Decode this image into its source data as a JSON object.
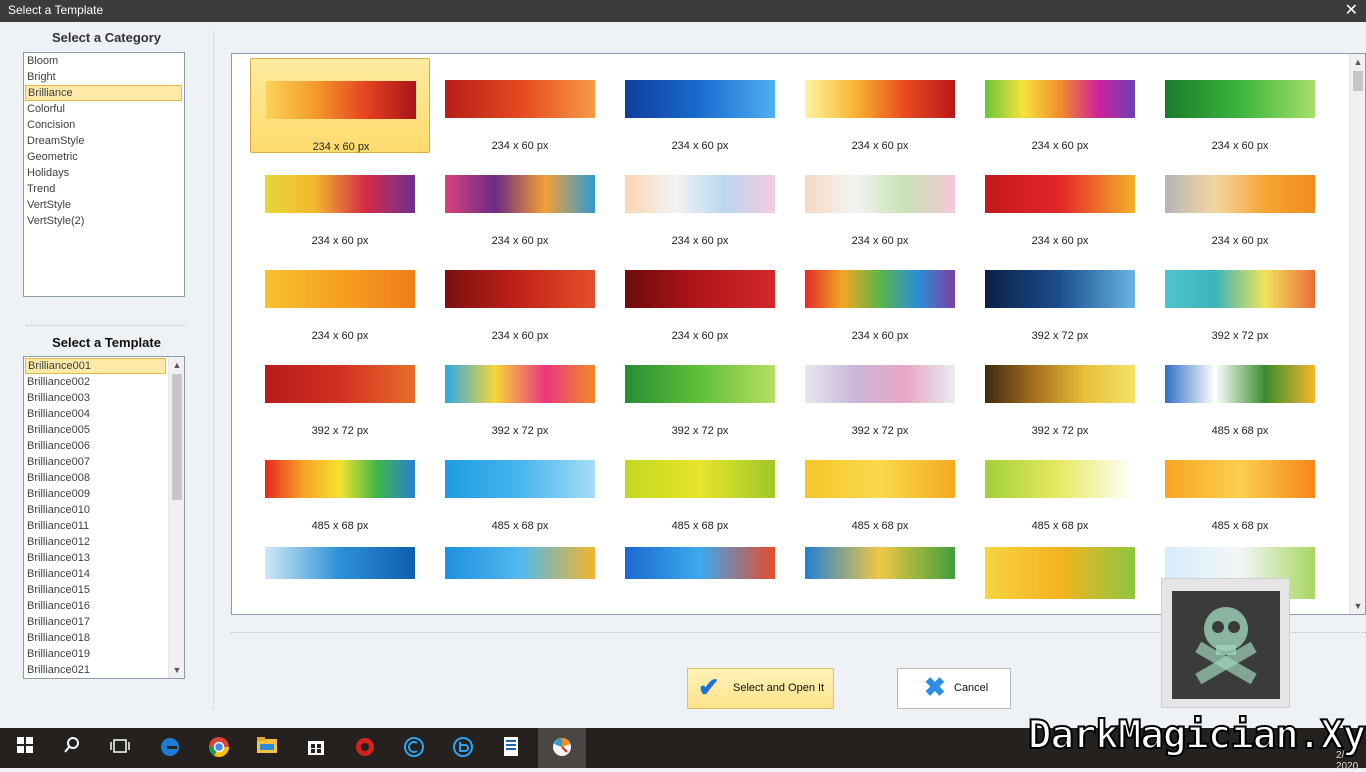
{
  "window": {
    "title": "Select a Template",
    "close_glyph": "✕"
  },
  "category": {
    "heading": "Select a Category",
    "items": [
      "Bloom",
      "Bright",
      "Brilliance",
      "Colorful",
      "Concision",
      "DreamStyle",
      "Geometric",
      "Holidays",
      "Trend",
      "VertStyle",
      "VertStyle(2)"
    ],
    "selected": "Brilliance"
  },
  "template": {
    "heading": "Select a Template",
    "items": [
      "Brilliance001",
      "Brilliance002",
      "Brilliance003",
      "Brilliance004",
      "Brilliance005",
      "Brilliance006",
      "Brilliance007",
      "Brilliance008",
      "Brilliance009",
      "Brilliance010",
      "Brilliance011",
      "Brilliance012",
      "Brilliance013",
      "Brilliance014",
      "Brilliance015",
      "Brilliance016",
      "Brilliance017",
      "Brilliance018",
      "Brilliance019",
      "Brilliance021"
    ],
    "selected": "Brilliance001"
  },
  "gallery": {
    "tiles": [
      {
        "size": "234 x 60 px",
        "selected": true,
        "colors": [
          "#fbd35a",
          "#f39a2a",
          "#e54220",
          "#a8141a"
        ]
      },
      {
        "size": "234 x 60 px",
        "colors": [
          "#b51f18",
          "#e5481e",
          "#f79a47"
        ]
      },
      {
        "size": "234 x 60 px",
        "colors": [
          "#0e3f9a",
          "#1b6bd0",
          "#4fb0ef"
        ]
      },
      {
        "size": "234 x 60 px",
        "colors": [
          "#fff3a0",
          "#f6b531",
          "#e94b1f",
          "#b8171b"
        ]
      },
      {
        "size": "234 x 60 px",
        "colors": [
          "#6ac43c",
          "#f4e33a",
          "#f08f2c",
          "#d2239a",
          "#6b3fb5"
        ]
      },
      {
        "size": "234 x 60 px",
        "colors": [
          "#1b7a2a",
          "#3ab53c",
          "#a6e06a"
        ]
      },
      {
        "size": "234 x 60 px",
        "colors": [
          "#e6d73a",
          "#f3b72e",
          "#d42c47",
          "#6e2f8f"
        ]
      },
      {
        "size": "234 x 60 px",
        "colors": [
          "#d9437b",
          "#6a2b86",
          "#f2a035",
          "#2f9ad6"
        ]
      },
      {
        "size": "234 x 60 px",
        "colors": [
          "#fbd5ae",
          "#f3f3f3",
          "#b9d7f0",
          "#f7c9de"
        ]
      },
      {
        "size": "234 x 60 px",
        "colors": [
          "#f8d9c2",
          "#f3f3f3",
          "#c6e3b5",
          "#f5c7d6"
        ]
      },
      {
        "size": "234 x 60 px",
        "colors": [
          "#c3181c",
          "#e4262a",
          "#f4b12b"
        ]
      },
      {
        "size": "234 x 60 px",
        "colors": [
          "#b5b5b5",
          "#f2d6a1",
          "#f6a534",
          "#ef8c1c"
        ]
      },
      {
        "size": "234 x 60 px",
        "colors": [
          "#f7c230",
          "#f7a01f",
          "#ef7d1a"
        ]
      },
      {
        "size": "234 x 60 px",
        "colors": [
          "#7a0f0f",
          "#c3221a",
          "#e5502a"
        ]
      },
      {
        "size": "234 x 60 px",
        "colors": [
          "#6d0b0b",
          "#b3151b",
          "#d3292a"
        ]
      },
      {
        "size": "234 x 60 px",
        "colors": [
          "#e22c2a",
          "#f2a623",
          "#5bb547",
          "#2b8fd6",
          "#7d3fa4"
        ]
      },
      {
        "size": "392 x 72 px",
        "colors": [
          "#0b1f46",
          "#1c4f8e",
          "#69b4e4"
        ]
      },
      {
        "size": "392 x 72 px",
        "colors": [
          "#52c3ce",
          "#3ab4b9",
          "#f2e35b",
          "#ea6d3a"
        ]
      },
      {
        "size": "392 x 72 px",
        "colors": [
          "#b71b1a",
          "#d22f22",
          "#e86d2a"
        ]
      },
      {
        "size": "392 x 72 px",
        "colors": [
          "#2ea7e3",
          "#f5d53a",
          "#e9377b",
          "#f28a2c"
        ]
      },
      {
        "size": "392 x 72 px",
        "colors": [
          "#2a8d34",
          "#5fbf3a",
          "#b7df61"
        ]
      },
      {
        "size": "392 x 72 px",
        "colors": [
          "#e6e6ef",
          "#c9b8d8",
          "#e6a6c3",
          "#ebebf2"
        ]
      },
      {
        "size": "392 x 72 px",
        "colors": [
          "#3c2a10",
          "#a5701f",
          "#e8c03a",
          "#f3e36a"
        ]
      },
      {
        "size": "485 x 68 px",
        "colors": [
          "#2f6fc4",
          "#ffffff",
          "#3a8c2f",
          "#f5b82a"
        ]
      },
      {
        "size": "485 x 68 px",
        "colors": [
          "#e6261f",
          "#f7a125",
          "#f4e22f",
          "#3db64a",
          "#2a7fd0"
        ]
      },
      {
        "size": "485 x 68 px",
        "colors": [
          "#1f9be2",
          "#46b6ee",
          "#a6dcf6"
        ]
      },
      {
        "size": "485 x 68 px",
        "colors": [
          "#c3d821",
          "#e9e42b",
          "#9ec728"
        ]
      },
      {
        "size": "485 x 68 px",
        "colors": [
          "#f6c62b",
          "#f9d94b",
          "#f3aa1f"
        ]
      },
      {
        "size": "485 x 68 px",
        "colors": [
          "#a2cf3a",
          "#e8ea62",
          "#ffffff"
        ]
      },
      {
        "size": "485 x 68 px",
        "colors": [
          "#f7a524",
          "#fbcf4e",
          "#f4871a"
        ]
      },
      {
        "size": "",
        "colors": [
          "#cfe9f6",
          "#2e8fd6",
          "#0e5fae"
        ]
      },
      {
        "size": "",
        "colors": [
          "#1f8fe0",
          "#52b9ef",
          "#f3b42c"
        ]
      },
      {
        "size": "",
        "colors": [
          "#1b6ad0",
          "#3da9ee",
          "#e84b2a"
        ]
      },
      {
        "size": "",
        "colors": [
          "#2480d3",
          "#f0c845",
          "#3e9e3a"
        ]
      },
      {
        "size": "",
        "colors": [
          "#f7d443",
          "#f4b31f",
          "#8dc63f"
        ]
      },
      {
        "size": "",
        "colors": [
          "#d5ecfb",
          "#f3f6f8",
          "#a8d660"
        ]
      }
    ]
  },
  "buttons": {
    "ok": "Select and Open It",
    "cancel": "Cancel"
  },
  "taskbar": {
    "icons": [
      "windows-icon",
      "search-icon",
      "task-view-icon",
      "edge-icon",
      "chrome-icon",
      "file-explorer-icon",
      "store-icon",
      "app-red-icon",
      "app-c-icon",
      "app-b-icon",
      "document-icon",
      "active-app-icon"
    ]
  },
  "watermark": "DarkMagician.Xyz",
  "clock_fragment": "2/ 2020"
}
